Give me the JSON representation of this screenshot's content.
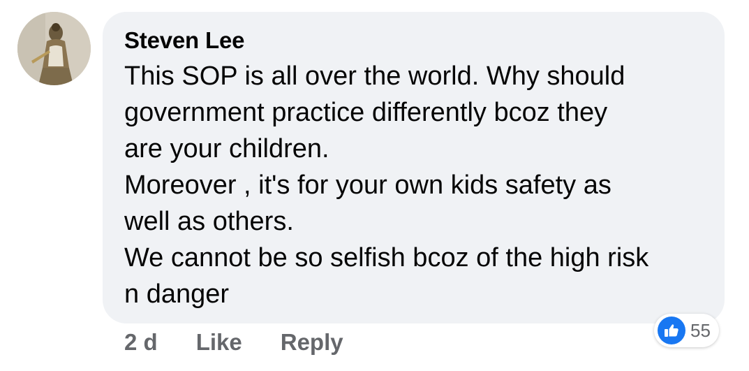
{
  "comment": {
    "author": "Steven Lee",
    "lines": [
      "This SOP is all over the world.  Why should",
      "government practice differently bcoz they",
      "are your children.",
      "Moreover , it's for your own kids safety as",
      "well as others.",
      "We cannot be so selfish bcoz of the high risk",
      "n danger"
    ],
    "time": "2 d",
    "like_label": "Like",
    "reply_label": "Reply",
    "reaction_count": "55",
    "reaction_icon": "thumbs-up-icon"
  },
  "colors": {
    "bubble": "#f0f2f5",
    "text": "#050505",
    "secondary_text": "#65676b",
    "like_blue": "#1877f2"
  }
}
